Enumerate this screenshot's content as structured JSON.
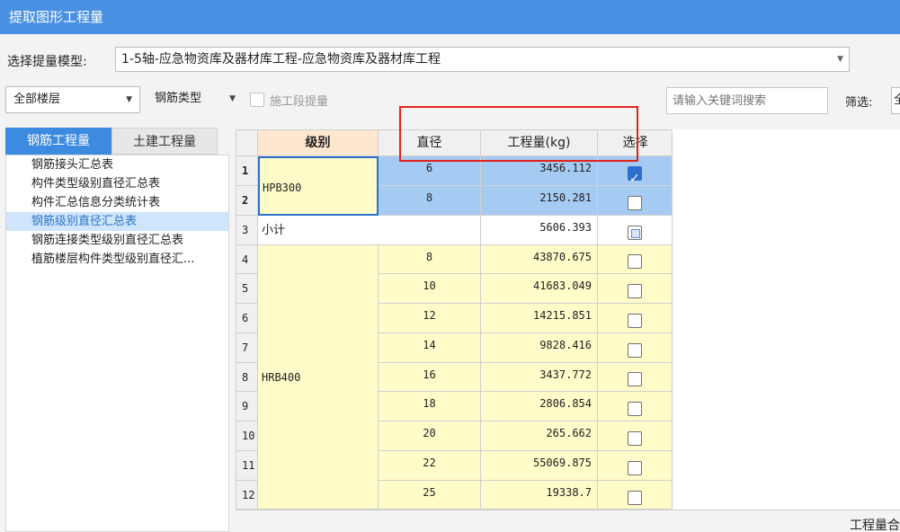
{
  "window": {
    "title": "提取图形工程量"
  },
  "model": {
    "label": "选择提量模型:",
    "value": "1-5轴-应急物资库及器材库工程-应急物资库及器材库工程"
  },
  "filters": {
    "floor": "全部楼层",
    "rebar_type": "钢筋类型",
    "segment_label": "施工段提量",
    "search_placeholder": "请输入关键词搜索",
    "filter_label": "筛选:",
    "filter_value": "全"
  },
  "tabs": [
    {
      "label": "钢筋工程量",
      "active": true
    },
    {
      "label": "土建工程量",
      "active": false
    }
  ],
  "report_list": [
    "钢筋接头汇总表",
    "构件类型级别直径汇总表",
    "构件汇总信息分类统计表",
    "钢筋级别直径汇总表",
    "钢筋连接类型级别直径汇总表",
    "植筋楼层构件类型级别直径汇..."
  ],
  "selected_report": 3,
  "table": {
    "headers": {
      "grade": "级别",
      "diameter": "直径",
      "qty": "工程量(kg)",
      "select": "选择"
    },
    "rows": [
      {
        "no": "1",
        "diameter": "6",
        "qty": "3456.112",
        "checked": true
      },
      {
        "no": "2",
        "diameter": "8",
        "qty": "2150.281",
        "checked": false
      },
      {
        "no": "3",
        "label": "小计",
        "qty": "5606.393",
        "partial": true
      },
      {
        "no": "4",
        "diameter": "8",
        "qty": "43870.675",
        "checked": false
      },
      {
        "no": "5",
        "diameter": "10",
        "qty": "41683.049",
        "checked": false
      },
      {
        "no": "6",
        "diameter": "12",
        "qty": "14215.851",
        "checked": false
      },
      {
        "no": "7",
        "diameter": "14",
        "qty": "9828.416",
        "checked": false
      },
      {
        "no": "8",
        "diameter": "16",
        "qty": "3437.772",
        "checked": false
      },
      {
        "no": "9",
        "diameter": "18",
        "qty": "2806.854",
        "checked": false
      },
      {
        "no": "10",
        "diameter": "20",
        "qty": "265.662",
        "checked": false
      },
      {
        "no": "11",
        "diameter": "22",
        "qty": "55069.875",
        "checked": false
      },
      {
        "no": "12",
        "diameter": "25",
        "qty": "19338.7",
        "checked": false
      }
    ],
    "groups": [
      {
        "grade": "HPB300"
      },
      {
        "grade": "HRB400"
      }
    ]
  },
  "footer": {
    "total_label": "工程量合"
  },
  "colors": {
    "accent": "#4a90e2",
    "annotation": "#e2231a",
    "selected_row": "#a6cbf3",
    "grade_cell": "#fffcc9"
  }
}
